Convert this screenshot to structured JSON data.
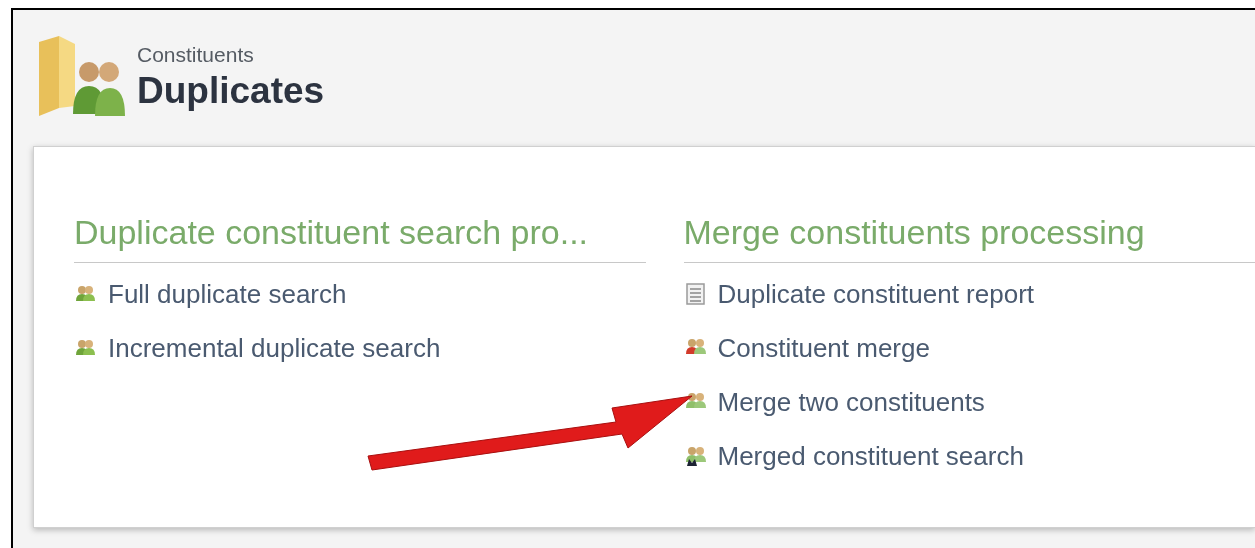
{
  "header": {
    "breadcrumb": "Constituents",
    "title": "Duplicates"
  },
  "sections": [
    {
      "heading": "Duplicate constituent search pro...",
      "items": [
        {
          "label": "Full duplicate search",
          "kind": "people"
        },
        {
          "label": "Incremental duplicate search",
          "kind": "people"
        }
      ]
    },
    {
      "heading": "Merge constituents processing",
      "items": [
        {
          "label": "Duplicate constituent report",
          "kind": "report"
        },
        {
          "label": "Constituent merge",
          "kind": "merge-red"
        },
        {
          "label": "Merge two constituents",
          "kind": "merge"
        },
        {
          "label": "Merged constituent search",
          "kind": "merge-search"
        }
      ]
    }
  ]
}
